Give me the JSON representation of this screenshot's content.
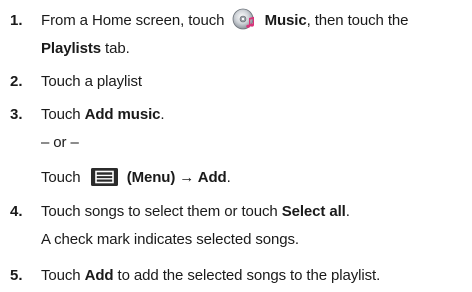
{
  "steps": [
    {
      "number": "1.",
      "lines": [
        {
          "before": "From a Home screen, touch",
          "icon": "music-app-icon",
          "bold": "Music",
          "after": ", then touch the"
        },
        {
          "bold": "Playlists",
          "after": " tab."
        }
      ]
    },
    {
      "number": "2.",
      "lines": [
        {
          "text": "Touch a playlist"
        }
      ]
    },
    {
      "number": "3.",
      "lines": [
        {
          "before": "Touch ",
          "bold": "Add music",
          "after": "."
        },
        {
          "text": "– or –"
        },
        {
          "before": "Touch",
          "icon": "menu-icon",
          "bold": "(Menu) → Add",
          "after": "."
        }
      ]
    },
    {
      "number": "4.",
      "lines": [
        {
          "before": "Touch songs to select them or touch ",
          "bold": "Select all",
          "after": "."
        },
        {
          "text": "A check mark indicates selected songs."
        }
      ]
    },
    {
      "number": "5.",
      "lines": [
        {
          "before": "Touch ",
          "bold": "Add",
          "after": " to add the selected songs to the playlist."
        }
      ]
    }
  ]
}
